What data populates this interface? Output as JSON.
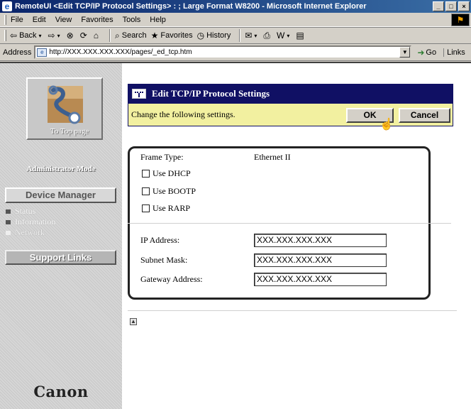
{
  "window": {
    "title": "RemoteUI <Edit TCP/IP Protocol Settings> : ; Large Format W8200 - Microsoft Internet Explorer",
    "controls": [
      "_",
      "□",
      "×"
    ]
  },
  "menu": [
    "File",
    "Edit",
    "View",
    "Favorites",
    "Tools",
    "Help"
  ],
  "toolbar": {
    "back": "Back",
    "search": "Search",
    "favorites": "Favorites",
    "history": "History"
  },
  "address": {
    "label": "Address",
    "url": "http://XXX.XXX.XXX.XXX/pages/_ed_tcp.htm",
    "go": "Go",
    "links": "Links"
  },
  "sidebar": {
    "top_page": "To Top page",
    "mode": "Administrator Mode",
    "device_manager": "Device Manager",
    "items": [
      "Status",
      "Information",
      "Network"
    ],
    "support_links": "Support Links",
    "brand": "Canon"
  },
  "panel": {
    "title": "Edit TCP/IP Protocol Settings",
    "message": "Change the following settings.",
    "ok": "OK",
    "cancel": "Cancel"
  },
  "settings": {
    "frame_type_label": "Frame Type:",
    "frame_type_value": "Ethernet II",
    "use_dhcp": "Use DHCP",
    "use_bootp": "Use BOOTP",
    "use_rarp": "Use RARP",
    "ip_label": "IP Address:",
    "ip_value": "XXX.XXX.XXX.XXX",
    "subnet_label": "Subnet Mask:",
    "subnet_value": "XXX.XXX.XXX.XXX",
    "gateway_label": "Gateway Address:",
    "gateway_value": "XXX.XXX.XXX.XXX"
  },
  "colors": {
    "header_bg": "#101064",
    "message_bar_bg": "#f2f0a0",
    "titlebar_start": "#0a246a"
  }
}
